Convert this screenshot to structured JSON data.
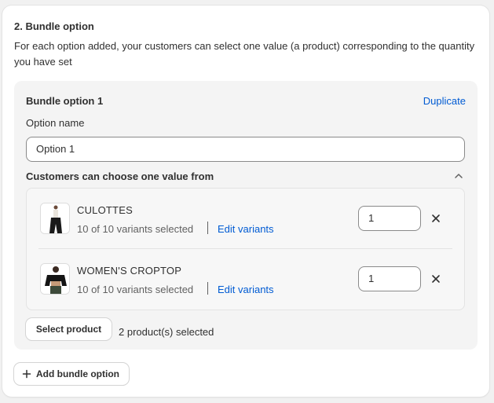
{
  "section": {
    "title": "2. Bundle option",
    "description": "For each option added, your customers can select one value (a product) corresponding to the quantity you have set"
  },
  "option": {
    "title": "Bundle option 1",
    "duplicate_label": "Duplicate",
    "name_label": "Option name",
    "name_value": "Option 1",
    "choose_label": "Customers can choose one value from",
    "products": [
      {
        "name": "CULOTTES",
        "variants": "10 of 10 variants selected",
        "edit_label": "Edit variants",
        "quantity": "1",
        "thumb_icon": "culottes-thumbnail"
      },
      {
        "name": "WOMEN'S CROPTOP",
        "variants": "10 of 10 variants selected",
        "edit_label": "Edit variants",
        "quantity": "1",
        "thumb_icon": "croptop-thumbnail"
      }
    ],
    "select_product_label": "Select product",
    "selected_count": "2 product(s) selected"
  },
  "add_bundle_label": "Add bundle option",
  "colors": {
    "link": "#005bd3",
    "text": "#303030",
    "muted": "#616161"
  }
}
